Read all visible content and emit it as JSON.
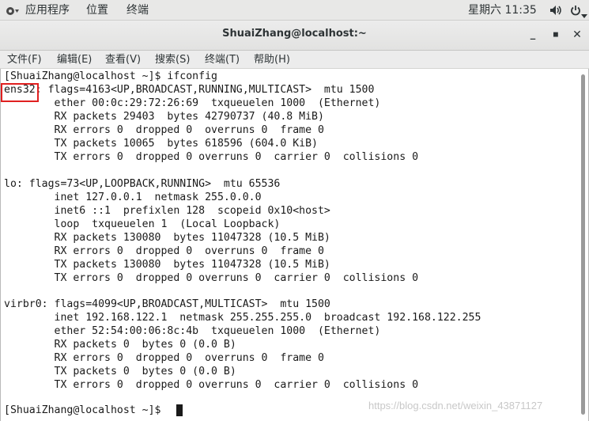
{
  "topbar": {
    "apps": "应用程序",
    "places": "位置",
    "terminal": "终端",
    "clock": "星期六 11:35",
    "volume_icon": "volume-icon",
    "power_icon": "power-icon"
  },
  "window": {
    "title": "ShuaiZhang@localhost:~",
    "minimize": "_",
    "maximize": "◼",
    "close": "✕"
  },
  "menu": {
    "file": "文件(F)",
    "edit": "编辑(E)",
    "view": "查看(V)",
    "search": "搜索(S)",
    "terminal": "终端(T)",
    "help": "帮助(H)"
  },
  "terminal": {
    "lines": [
      "[ShuaiZhang@localhost ~]$ ifconfig",
      "ens32: flags=4163<UP,BROADCAST,RUNNING,MULTICAST>  mtu 1500",
      "        ether 00:0c:29:72:26:69  txqueuelen 1000  (Ethernet)",
      "        RX packets 29403  bytes 42790737 (40.8 MiB)",
      "        RX errors 0  dropped 0  overruns 0  frame 0",
      "        TX packets 10065  bytes 618596 (604.0 KiB)",
      "        TX errors 0  dropped 0 overruns 0  carrier 0  collisions 0",
      "",
      "lo: flags=73<UP,LOOPBACK,RUNNING>  mtu 65536",
      "        inet 127.0.0.1  netmask 255.0.0.0",
      "        inet6 ::1  prefixlen 128  scopeid 0x10<host>",
      "        loop  txqueuelen 1  (Local Loopback)",
      "        RX packets 130080  bytes 11047328 (10.5 MiB)",
      "        RX errors 0  dropped 0  overruns 0  frame 0",
      "        TX packets 130080  bytes 11047328 (10.5 MiB)",
      "        TX errors 0  dropped 0 overruns 0  carrier 0  collisions 0",
      "",
      "virbr0: flags=4099<UP,BROADCAST,MULTICAST>  mtu 1500",
      "        inet 192.168.122.1  netmask 255.255.255.0  broadcast 192.168.122.255",
      "        ether 52:54:00:06:8c:4b  txqueuelen 1000  (Ethernet)",
      "        RX packets 0  bytes 0 (0.0 B)",
      "        RX errors 0  dropped 0  overruns 0  frame 0",
      "        TX packets 0  bytes 0 (0.0 B)",
      "        TX errors 0  dropped 0 overruns 0  carrier 0  collisions 0",
      "",
      "[ShuaiZhang@localhost ~]$ "
    ]
  },
  "watermark": "https://blog.csdn.net/weixin_43871127",
  "colors": {
    "highlight_box": "#e02020",
    "terminal_bg": "#ffffff",
    "terminal_fg": "#1a1a1a"
  }
}
